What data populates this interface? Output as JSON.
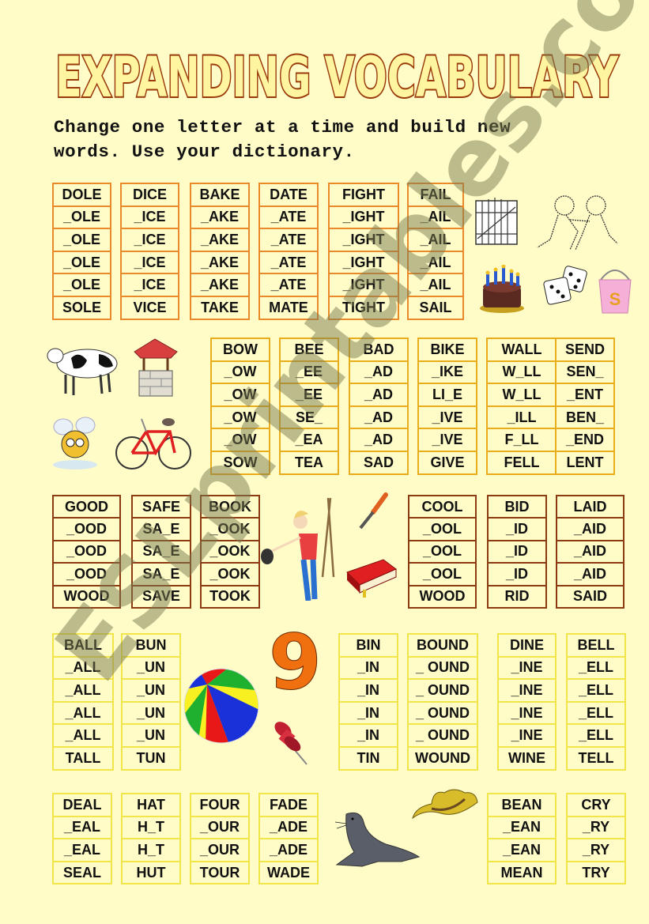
{
  "title": "EXPANDING VOCABULARY",
  "instructions": [
    "Change one letter at a time and build new",
    "words. Use your dictionary."
  ],
  "watermark": "ESLprintables.com",
  "colors": {
    "background": "#fffcc8",
    "title_fill": "#fff5a0",
    "title_stroke": "#9a3a0a",
    "border_orange": "#e8892a",
    "border_gold": "#e9ad1c",
    "border_brown": "#8b3a12",
    "border_yellow": "#f2e54a",
    "nine_color": "#f07010"
  },
  "section1": [
    [
      "DOLE",
      "_OLE",
      "_OLE",
      "_OLE",
      "_OLE",
      "SOLE"
    ],
    [
      "DICE",
      "_ICE",
      "_ICE",
      "_ICE",
      "_ICE",
      "VICE"
    ],
    [
      "BAKE",
      "_AKE",
      "_AKE",
      "_AKE",
      "_AKE",
      "TAKE"
    ],
    [
      "DATE",
      "_ATE",
      "_ATE",
      "_ATE",
      "_ATE",
      "MATE"
    ],
    [
      "FIGHT",
      "_IGHT",
      "_IGHT",
      "_IGHT",
      "_IGHT",
      "TIGHT"
    ],
    [
      "FAIL",
      "_AIL",
      "_AIL",
      "_AIL",
      "_AIL",
      "SAIL"
    ]
  ],
  "section2": [
    [
      "BOW",
      "_OW",
      "_OW",
      "_OW",
      "_OW",
      "SOW"
    ],
    [
      "BEE",
      "_EE",
      "_EE",
      "SE_",
      "_EA",
      "TEA"
    ],
    [
      "BAD",
      "_AD",
      "_AD",
      "_AD",
      "_AD",
      "SAD"
    ],
    [
      "BIKE",
      "_IKE",
      "LI_E",
      "_IVE",
      "_IVE",
      "GIVE"
    ],
    [
      "WALL",
      "W_LL",
      "W_LL",
      "_ILL",
      "F_LL",
      "FELL"
    ],
    [
      "SEND",
      "SEN_",
      "_ENT",
      "BEN_",
      "_END",
      "LENT"
    ]
  ],
  "section3_left": [
    [
      "GOOD",
      "_OOD",
      "_OOD",
      "_OOD",
      "WOOD"
    ],
    [
      "SAFE",
      "SA_E",
      "SA_E",
      "SA_E",
      "SAVE"
    ],
    [
      "BOOK",
      "_OOK",
      "_OOK",
      "_OOK",
      "TOOK"
    ]
  ],
  "section3_right": [
    [
      "COOL",
      "_OOL",
      "_OOL",
      "_OOL",
      "WOOD"
    ],
    [
      "BID",
      "_ID",
      "_ID",
      "_ID",
      "RID"
    ],
    [
      "LAID",
      "_AID",
      "_AID",
      "_AID",
      "SAID"
    ]
  ],
  "section4_left": [
    [
      "BALL",
      "_ALL",
      "_ALL",
      "_ALL",
      "_ALL",
      "TALL"
    ],
    [
      "BUN",
      "_UN",
      "_UN",
      "_UN",
      "_UN",
      "TUN"
    ]
  ],
  "section4_right": [
    [
      "BIN",
      "_IN",
      "_IN",
      "_IN",
      "_IN",
      "TIN"
    ],
    [
      "BOUND",
      "_ OUND",
      "_ OUND",
      "_ OUND",
      "_ OUND",
      "WOUND"
    ],
    [
      "DINE",
      "_INE",
      "_INE",
      "_INE",
      "_INE",
      "WINE"
    ],
    [
      "BELL",
      "_ELL",
      "_ELL",
      "_ELL",
      "_ELL",
      "TELL"
    ]
  ],
  "section5_left": [
    [
      "DEAL",
      "_EAL",
      "_EAL",
      "SEAL"
    ],
    [
      "HAT",
      "H_T",
      "H_T",
      "HUT"
    ],
    [
      "FOUR",
      "_OUR",
      "_OUR",
      "TOUR"
    ],
    [
      "FADE",
      "_ADE",
      "_ADE",
      "WADE"
    ]
  ],
  "section5_right": [
    [
      "BEAN",
      "_EAN",
      "_EAN",
      "MEAN"
    ],
    [
      "CRY",
      "_RY",
      "_RY",
      "TRY"
    ]
  ],
  "number_graphic": "9",
  "pictures": [
    "gate",
    "fighting-boys",
    "birthday-cake",
    "dice",
    "pail",
    "cow",
    "wishing-well",
    "bee",
    "bicycle",
    "woman-cleaning",
    "chisel",
    "book",
    "beach-ball",
    "number-nine",
    "push-pin",
    "seal",
    "hat"
  ]
}
